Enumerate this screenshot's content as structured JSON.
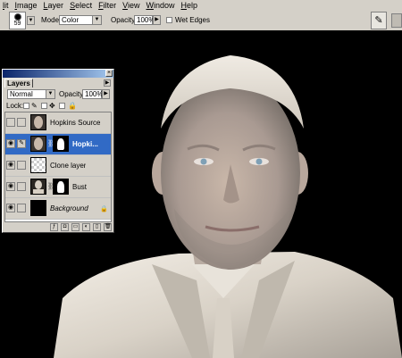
{
  "menu": [
    "lit",
    "Image",
    "Layer",
    "Select",
    "Filter",
    "View",
    "Window",
    "Help"
  ],
  "options_bar": {
    "brush_size": "59",
    "mode_label": "Mode:",
    "mode_value": "Color",
    "opacity_label": "Opacity:",
    "opacity_value": "100%",
    "wet_edges_label": "Wet Edges",
    "wet_edges_checked": false
  },
  "layers_panel": {
    "tab_label": "Layers",
    "blend_mode": "Normal",
    "opacity_label": "Opacity:",
    "opacity_value": "100%",
    "lock_label": "Lock:",
    "layers": [
      {
        "name": "Hopkins Source",
        "visible": false,
        "selected": false,
        "has_mask": false,
        "locked": false
      },
      {
        "name": "Hopki...",
        "visible": true,
        "selected": true,
        "has_mask": true,
        "locked": false
      },
      {
        "name": "Clone layer",
        "visible": true,
        "selected": false,
        "has_mask": false,
        "locked": false
      },
      {
        "name": "Bust",
        "visible": true,
        "selected": false,
        "has_mask": true,
        "locked": false
      },
      {
        "name": "Background",
        "visible": true,
        "selected": false,
        "has_mask": false,
        "locked": true
      }
    ]
  },
  "colors": {
    "ui_gray": "#d4d0c8",
    "selection_blue": "#316ac5",
    "title_blue": "#0a246a"
  }
}
